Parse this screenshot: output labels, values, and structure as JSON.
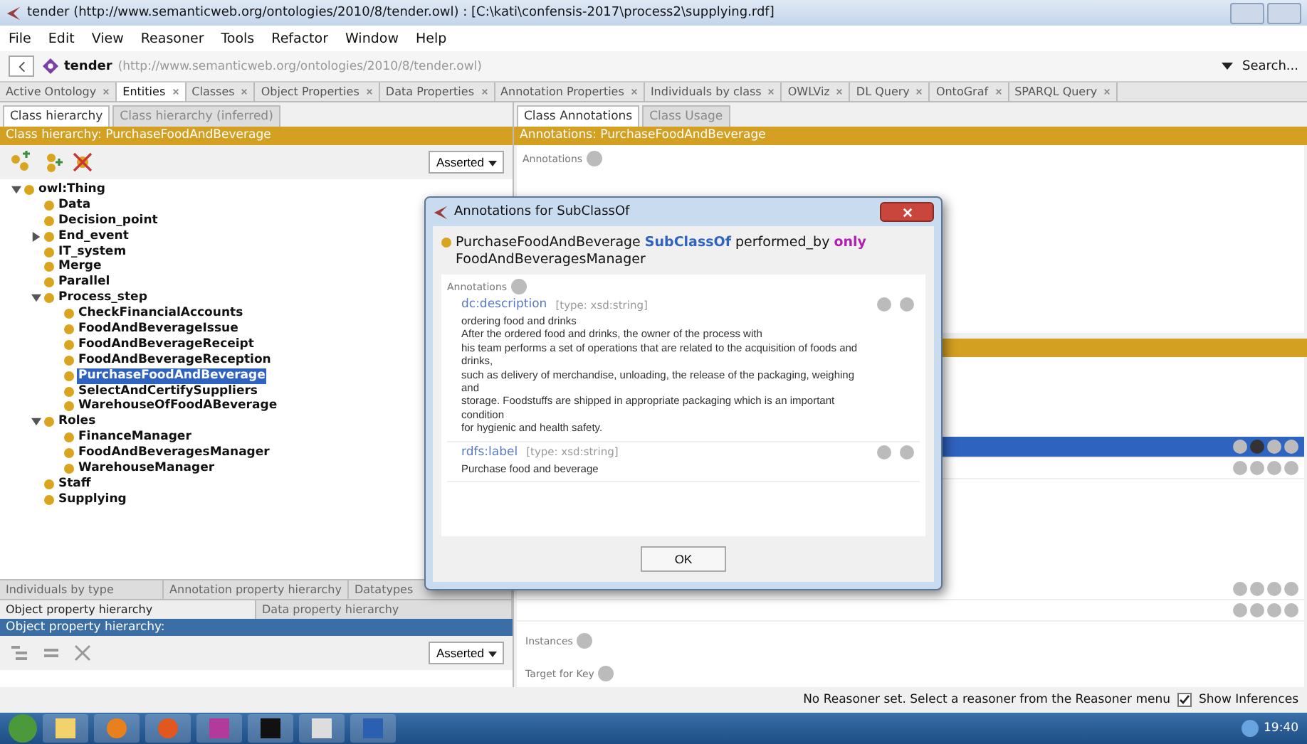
{
  "window": {
    "title": "tender (http://www.semanticweb.org/ontologies/2010/8/tender.owl) : [C:\\kati\\confensis-2017\\process2\\supplying.rdf]"
  },
  "menu": [
    "File",
    "Edit",
    "View",
    "Reasoner",
    "Tools",
    "Refactor",
    "Window",
    "Help"
  ],
  "address": {
    "name": "tender",
    "url": "(http://www.semanticweb.org/ontologies/2010/8/tender.owl)",
    "search": "Search..."
  },
  "tabs": [
    {
      "label": "Active Ontology",
      "selected": false
    },
    {
      "label": "Entities",
      "selected": true
    },
    {
      "label": "Classes",
      "selected": false
    },
    {
      "label": "Object Properties",
      "selected": false
    },
    {
      "label": "Data Properties",
      "selected": false
    },
    {
      "label": "Annotation Properties",
      "selected": false
    },
    {
      "label": "Individuals by class",
      "selected": false
    },
    {
      "label": "OWLViz",
      "selected": false
    },
    {
      "label": "DL Query",
      "selected": false
    },
    {
      "label": "OntoGraf",
      "selected": false
    },
    {
      "label": "SPARQL Query",
      "selected": false
    }
  ],
  "class_panel": {
    "tabs": [
      {
        "label": "Class hierarchy",
        "selected": true
      },
      {
        "label": "Class hierarchy (inferred)",
        "selected": false
      }
    ],
    "header": "Class hierarchy: PurchaseFoodAndBeverage",
    "mode": "Asserted",
    "tree": [
      {
        "label": "owl:Thing",
        "expanded": true,
        "selected": false,
        "children": [
          {
            "label": "Data",
            "selected": false
          },
          {
            "label": "Decision_point",
            "selected": false
          },
          {
            "label": "End_event",
            "expanded": false,
            "selected": false
          },
          {
            "label": "IT_system",
            "selected": false
          },
          {
            "label": "Merge",
            "selected": false
          },
          {
            "label": "Parallel",
            "selected": false
          },
          {
            "label": "Process_step",
            "expanded": true,
            "selected": false,
            "children": [
              {
                "label": "CheckFinancialAccounts",
                "selected": false
              },
              {
                "label": "FoodAndBeverageIssue",
                "selected": false
              },
              {
                "label": "FoodAndBeverageReceipt",
                "selected": false
              },
              {
                "label": "FoodAndBeverageReception",
                "selected": false
              },
              {
                "label": "PurchaseFoodAndBeverage",
                "selected": true
              },
              {
                "label": "SelectAndCertifySuppliers",
                "selected": false
              },
              {
                "label": "WarehouseOfFoodABeverage",
                "selected": false
              }
            ]
          },
          {
            "label": "Roles",
            "expanded": true,
            "selected": false,
            "children": [
              {
                "label": "FinanceManager",
                "selected": false
              },
              {
                "label": "FoodAndBeveragesManager",
                "selected": false
              },
              {
                "label": "WarehouseManager",
                "selected": false
              }
            ]
          },
          {
            "label": "Staff",
            "selected": false
          },
          {
            "label": "Supplying",
            "selected": false
          }
        ]
      }
    ]
  },
  "lower_panel": {
    "tab_rows": [
      [
        {
          "label": "Individuals by type",
          "selected": false
        },
        {
          "label": "Annotation property hierarchy",
          "selected": false
        },
        {
          "label": "Datatypes",
          "selected": false
        }
      ],
      [
        {
          "label": "Object property hierarchy",
          "selected": true
        },
        {
          "label": "Data property hierarchy",
          "selected": false
        }
      ]
    ],
    "header": "Object property hierarchy:",
    "mode": "Asserted"
  },
  "right_panel": {
    "tabs": [
      {
        "label": "Class Annotations",
        "selected": true
      },
      {
        "label": "Class Usage",
        "selected": false
      }
    ],
    "header": "Annotations: PurchaseFoodAndBeverage",
    "annotations_label": "Annotations",
    "axiom_rows": [
      {
        "selected": true
      },
      {
        "selected": false
      },
      {
        "selected": false
      },
      {
        "selected": false
      }
    ],
    "sections": [
      "Instances",
      "Target for Key"
    ]
  },
  "dialog": {
    "title": "Annotations for SubClassOf",
    "axiom": "PurchaseFoodAndBeverage **SubClassOf** performed_by **only** FoodAndBeveragesManager",
    "annotations_label": "Annotations",
    "annotations": [
      {
        "property": "dc:description",
        "type": "[type: xsd:string]",
        "lines": [
          "ordering food and drinks",
          "After the ordered food and drinks, the owner of the process with",
          "his team performs a set of operations that are related to the acquisition of foods and",
          "drinks,",
          "such as delivery of merchandise, unloading, the release of the packaging, weighing",
          "and",
          "storage. Foodstuffs are shipped in appropriate packaging which is an important",
          "condition",
          "for hygienic and health safety."
        ]
      },
      {
        "property": "rdfs:label",
        "type": "[type: xsd:string]",
        "lines": [
          "Purchase food and beverage"
        ]
      }
    ],
    "ok": "OK"
  },
  "status": {
    "message": "No Reasoner set. Select a reasoner from the Reasoner menu",
    "show_inferences": {
      "label": "Show Inferences",
      "checked": true
    }
  },
  "taskbar": {
    "time": "19:40"
  }
}
